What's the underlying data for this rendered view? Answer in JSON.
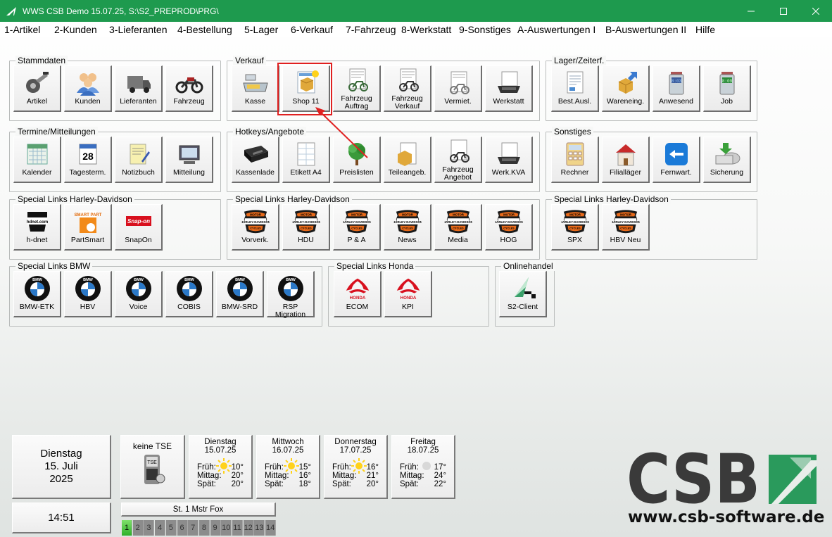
{
  "window": {
    "title": "WWS CSB Demo  15.07.25, S:\\S2_PREPROD\\PRG\\"
  },
  "menu": [
    "1-Artikel",
    "2-Kunden",
    "3-Lieferanten",
    "4-Bestellung",
    "5-Lager",
    "6-Verkauf",
    "7-Fahrzeug",
    "8-Werkstatt",
    "9-Sonstiges",
    "A-Auswertungen I",
    "B-Auswertungen II",
    "Hilfe"
  ],
  "groups": {
    "stammdaten": {
      "title": "Stammdaten",
      "buttons": [
        "Artikel",
        "Kunden",
        "Lieferanten",
        "Fahrzeug"
      ]
    },
    "verkauf": {
      "title": "Verkauf",
      "buttons": [
        "Kasse",
        "Shop 11",
        "Fahrzeug\nAuftrag",
        "Fahrzeug\nVerkauf",
        "Vermiet.",
        "Werkstatt"
      ]
    },
    "lager": {
      "title": "Lager/Zeiterf.",
      "buttons": [
        "Best.Ausl.",
        "Wareneing.",
        "Anwesend",
        "Job"
      ]
    },
    "termine": {
      "title": "Termine/Mitteilungen",
      "buttons": [
        "Kalender",
        "Tagesterm.",
        "Notizbuch",
        "Mitteilung"
      ]
    },
    "hotkeys": {
      "title": "Hotkeys/Angebote",
      "buttons": [
        "Kassenlade",
        "Etikett A4",
        "Preislisten",
        "Teileangeb.",
        "Fahrzeug\nAngebot",
        "Werk.KVA"
      ]
    },
    "sonstiges": {
      "title": "Sonstiges",
      "buttons": [
        "Rechner",
        "Filialläger",
        "Fernwart.",
        "Sicherung"
      ]
    },
    "hd1": {
      "title": "Special Links Harley-Davidson",
      "buttons": [
        "h-dnet",
        "PartSmart",
        "SnapOn"
      ]
    },
    "hd2": {
      "title": "Special Links Harley-Davidson",
      "buttons": [
        "Vorverk.",
        "HDU",
        "P & A",
        "News",
        "Media",
        "HOG"
      ]
    },
    "hd3": {
      "title": "Special Links Harley-Davidson",
      "buttons": [
        "SPX",
        "HBV Neu"
      ]
    },
    "bmw": {
      "title": "Special Links BMW",
      "buttons": [
        "BMW-ETK",
        "HBV",
        "Voice",
        "COBIS",
        "BMW-SRD",
        "RSP Migration"
      ]
    },
    "honda": {
      "title": "Special Links Honda",
      "buttons": [
        "ECOM",
        "KPI"
      ]
    },
    "online": {
      "title": "Onlinehandel",
      "buttons": [
        "S2-Client"
      ]
    }
  },
  "icons": {
    "hdnet_logo": "hdnet.com",
    "partsmart_logo": "SMART PART",
    "snapon_logo": "Snap-on",
    "tagesterm_day": "28",
    "honda_logo": "HONDA",
    "bmw_logo": "BMW",
    "hd_logo_top": "MOTOR",
    "hd_logo_mid": "HARLEY-DAVIDSON",
    "hd_logo_bot": "CYCLES",
    "tse_chip": "TSE",
    "s2_logo": "S",
    "job_clock": "8:09",
    "anwesend_clock": "8:03"
  },
  "status": {
    "date": {
      "weekday": "Dienstag",
      "day": "15. Juli",
      "year": "2025"
    },
    "time": "14:51",
    "tse": "keine TSE",
    "station": "St. 1 Mstr Fox",
    "slots": [
      "1",
      "2",
      "3",
      "4",
      "5",
      "6",
      "7",
      "8",
      "9",
      "10",
      "11",
      "12",
      "13",
      "14"
    ],
    "active_slot": "1",
    "weather": [
      {
        "day": "Dienstag",
        "date": "15.07.25",
        "frueh": "10°",
        "mittag": "20°",
        "spaet": "20°",
        "sun": true
      },
      {
        "day": "Mittwoch",
        "date": "16.07.25",
        "frueh": "15°",
        "mittag": "16°",
        "spaet": "18°",
        "sun": true
      },
      {
        "day": "Donnerstag",
        "date": "17.07.25",
        "frueh": "16°",
        "mittag": "21°",
        "spaet": "20°",
        "sun": true
      },
      {
        "day": "Freitag",
        "date": "18.07.25",
        "frueh": "17°",
        "mittag": "24°",
        "spaet": "22°",
        "sun": false
      }
    ],
    "labels": {
      "frueh": "Früh:",
      "mittag": "Mittag:",
      "spaet": "Spät:"
    }
  },
  "brand": {
    "logo": "CSB",
    "url": "www.csb-software.de",
    "accent": "#1e9a4e"
  }
}
